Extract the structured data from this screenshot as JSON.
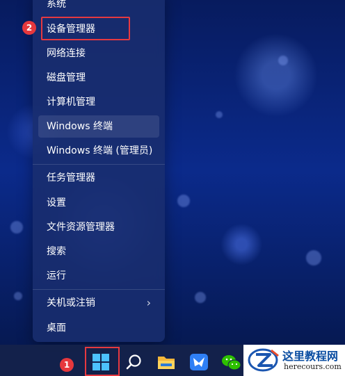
{
  "context_menu": {
    "items": [
      {
        "label": "系统"
      },
      {
        "label": "设备管理器"
      },
      {
        "label": "网络连接"
      },
      {
        "label": "磁盘管理"
      },
      {
        "label": "计算机管理"
      },
      {
        "label": "Windows 终端"
      },
      {
        "label": "Windows 终端 (管理员)"
      },
      {
        "label": "任务管理器"
      },
      {
        "label": "设置"
      },
      {
        "label": "文件资源管理器"
      },
      {
        "label": "搜索"
      },
      {
        "label": "运行"
      },
      {
        "label": "关机或注销"
      },
      {
        "label": "桌面"
      }
    ],
    "submenu_chevron": "›",
    "hovered_item": "Windows 终端"
  },
  "annotations": {
    "step1": "1",
    "step2": "2",
    "highlight_color": "#e63940"
  },
  "taskbar": {
    "icons": [
      "windows-start-icon",
      "search-icon",
      "file-explorer-icon",
      "feishu-icon",
      "wechat-icon"
    ]
  },
  "watermark": {
    "title": "这里教程网",
    "url": "herecours.com"
  }
}
